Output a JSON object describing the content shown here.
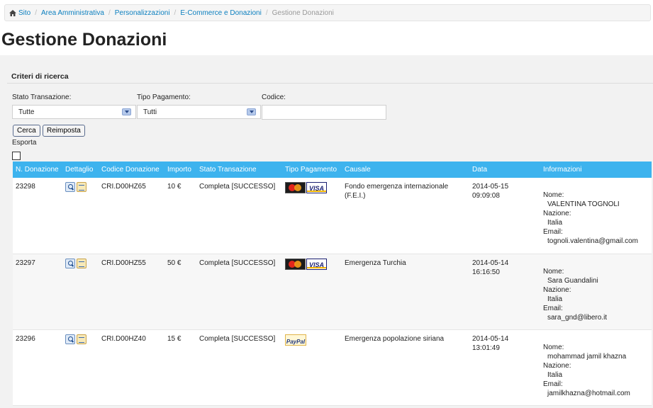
{
  "breadcrumb": {
    "items": [
      "Sito",
      "Area Amministrativa",
      "Personalizzazioni",
      "E-Commerce e Donazioni"
    ],
    "current": "Gestione Donazioni",
    "separator": "/"
  },
  "page": {
    "title": "Gestione Donazioni"
  },
  "search": {
    "legend": "Criteri di ricerca",
    "stato_label": "Stato Transazione:",
    "stato_value": "Tutte",
    "tipo_label": "Tipo Pagamento:",
    "tipo_value": "Tutti",
    "codice_label": "Codice:",
    "codice_value": "",
    "cerca_label": "Cerca",
    "reimposta_label": "Reimposta",
    "esporta_label": "Esporta"
  },
  "table": {
    "headers": {
      "n": "N. Donazione",
      "dettaglio": "Dettaglio",
      "codice": "Codice Donazione",
      "importo": "Importo",
      "stato": "Stato Transazione",
      "tipo": "Tipo Pagamento",
      "causale": "Causale",
      "data": "Data",
      "info": "Informazioni"
    },
    "info_labels": {
      "nome": "Nome:",
      "nazione": "Nazione:",
      "email": "Email:"
    },
    "rows": [
      {
        "n": "23298",
        "codice": "CRI.D00HZ65",
        "importo": "10 €",
        "stato": "Completa [SUCCESSO]",
        "causale": "Fondo emergenza internazionale (F.E.I.)",
        "data": "2014-05-15",
        "ora": "09:09:08",
        "nome": "VALENTINA TOGNOLI",
        "nazione": "Italia",
        "email": "tognoli.valentina@gmail.com"
      },
      {
        "n": "23297",
        "codice": "CRI.D00HZ55",
        "importo": "50 €",
        "stato": "Completa [SUCCESSO]",
        "causale": "Emergenza Turchia",
        "data": "2014-05-14",
        "ora": "16:16:50",
        "nome": "Sara Guandalini",
        "nazione": "Italia",
        "email": "sara_gnd@libero.it"
      },
      {
        "n": "23296",
        "codice": "CRI.D00HZ40",
        "importo": "15 €",
        "stato": "Completa [SUCCESSO]",
        "causale": "Emergenza popolazione siriana",
        "data": "2014-05-14",
        "ora": "13:01:49",
        "nome": "mohammad jamil khazna",
        "nazione": "Italia",
        "email": "jamilkhazna@hotmail.com"
      }
    ],
    "card_text": {
      "visa": "VISA",
      "paypal": "PayPal"
    }
  }
}
